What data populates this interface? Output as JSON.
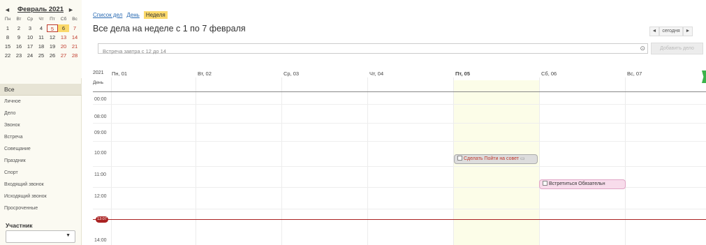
{
  "calendar": {
    "prev": "◄",
    "next": "►",
    "month": "Февраль 2021",
    "weekdays": [
      "Пн",
      "Вт",
      "Ср",
      "Чт",
      "Пт",
      "Сб",
      "Вс"
    ],
    "weeks": [
      [
        "1",
        "2",
        "3",
        "4",
        "5",
        "6",
        "7"
      ],
      [
        "8",
        "9",
        "10",
        "11",
        "12",
        "13",
        "14"
      ],
      [
        "15",
        "16",
        "17",
        "18",
        "19",
        "20",
        "21"
      ],
      [
        "22",
        "23",
        "24",
        "25",
        "26",
        "27",
        "28"
      ]
    ]
  },
  "categories": {
    "all": "Все",
    "items": [
      "Личное",
      "Дело",
      "Звонок",
      "Встреча",
      "Совещание",
      "Праздник",
      "Спорт",
      "Входящий звонок",
      "Исходящий звонок",
      "Просроченные"
    ]
  },
  "participant": {
    "label": "Участник",
    "value": "",
    "arrow": "▼"
  },
  "tabs": {
    "list": "Список дел",
    "day": "День",
    "week": "Неделя"
  },
  "heading": "Все дела  на неделе с 1 по 7 февраля",
  "nav": {
    "prev": "◄",
    "today": "сегодня",
    "next": "►"
  },
  "quick_add": {
    "placeholder": "Встреча завтра с 12 до 14",
    "add_button": "Добавить дело"
  },
  "grid": {
    "year": "2021",
    "day_label": "День",
    "days": [
      "Пн, 01",
      "Вт, 02",
      "Ср, 03",
      "Чт, 04",
      "Пт, 05",
      "Сб, 06",
      "Вс, 07"
    ],
    "times": [
      "00:00",
      "08:00",
      "09:00",
      "10:00",
      "11:00",
      "12:00",
      "14:00"
    ],
    "now": "13:07"
  },
  "events": [
    {
      "title": "Сделать Пойти на совет",
      "icon": "comment-icon"
    },
    {
      "title": "Встретиться Обязательн"
    }
  ],
  "colors": {
    "highlight": "#fbd96b",
    "today_border": "#c0392b",
    "now_line": "#aa2222",
    "friday_bg": "#fcfde8",
    "event_pink": "#f8dceb"
  }
}
